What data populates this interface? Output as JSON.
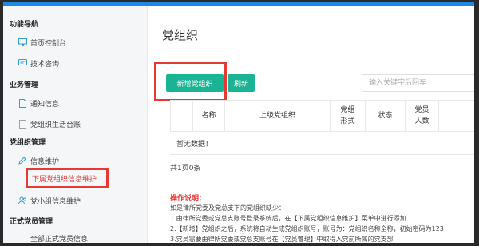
{
  "sidebar": {
    "sections": [
      {
        "title": "功能导航",
        "items": [
          {
            "label": "首页控制台",
            "icon": "monitor-icon"
          },
          {
            "label": "技术咨询",
            "icon": "headset-icon"
          }
        ]
      },
      {
        "title": "业务管理",
        "items": [
          {
            "label": "通知信息",
            "icon": "document-icon"
          },
          {
            "label": "党组织生活台账",
            "icon": "ledger-icon"
          }
        ]
      },
      {
        "title": "党组织管理",
        "items": [
          {
            "label": "信息维护",
            "icon": "edit-icon"
          },
          {
            "label": "下属党组织信息维护",
            "icon": ""
          },
          {
            "label": "党小组信息维护",
            "icon": "users-icon"
          }
        ]
      },
      {
        "title": "正式党员管理",
        "items": [
          {
            "label": "全部正式党员信息",
            "icon": ""
          }
        ]
      }
    ]
  },
  "main": {
    "title": "党组织",
    "buttons": {
      "new": "新增党组织",
      "refresh": "刷新"
    },
    "search_placeholder": "输入关键字后回车",
    "table": {
      "headers": [
        "名称",
        "上级党组织",
        "党组形式",
        "状态",
        "党员人数"
      ],
      "empty_text": "暂无数据！"
    },
    "pager_text": "共1页0条",
    "instructions": {
      "title": "操作说明：",
      "lines": [
        "如是律所党委及党总支下的党组织缺少：",
        "1.由律所党委或党总支账号登录系统后，在【下属党组织信息维护】菜单中进行添加",
        "2.【新增】党组织之后，系统将自动生成党组织账号，账号为：党组织名称全称，初始密码为123",
        "3.党员需要由律所党委或党总支账号在【党员管理】中取得入党前所属的党支部"
      ]
    }
  },
  "colors": {
    "accent": "#1ab394",
    "highlight_box": "#e53935",
    "active_link": "#e23c3c"
  }
}
